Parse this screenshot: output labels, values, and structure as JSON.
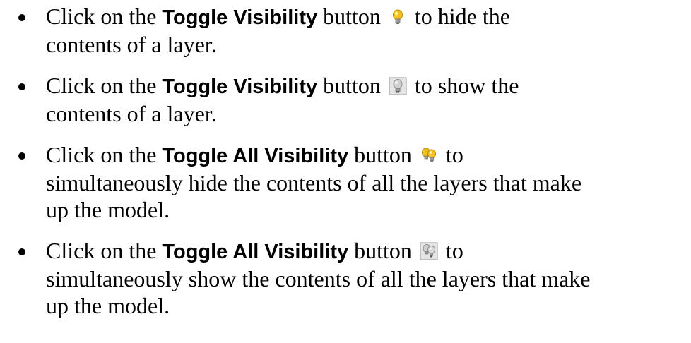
{
  "items": [
    {
      "pre": "Click on the ",
      "bold": "Toggle Visibility",
      "mid": " button ",
      "icon": "lightbulb-on-icon",
      "post": " to hide the",
      "post2": "contents of a layer."
    },
    {
      "pre": "Click on the ",
      "bold": "Toggle Visibility",
      "mid": " button ",
      "icon": "lightbulb-off-icon",
      "post": " to show the",
      "post2": "contents of a layer."
    },
    {
      "pre": "Click on the ",
      "bold": "Toggle All Visibility",
      "mid": " button ",
      "icon": "lightbulbs-on-icon",
      "post": " to",
      "post2": "simultaneously hide the contents of all the layers that make",
      "post3": "up the model."
    },
    {
      "pre": "Click on the ",
      "bold": "Toggle All Visibility",
      "mid": " button ",
      "icon": "lightbulbs-off-icon",
      "post": " to",
      "post2": "simultaneously show the contents of all the layers that make",
      "post3": "up the model."
    }
  ],
  "colors": {
    "bulb_on": "#f4c21e",
    "bulb_off": "#c8c8c8",
    "icon_bg_off": "#d8d8d8"
  }
}
